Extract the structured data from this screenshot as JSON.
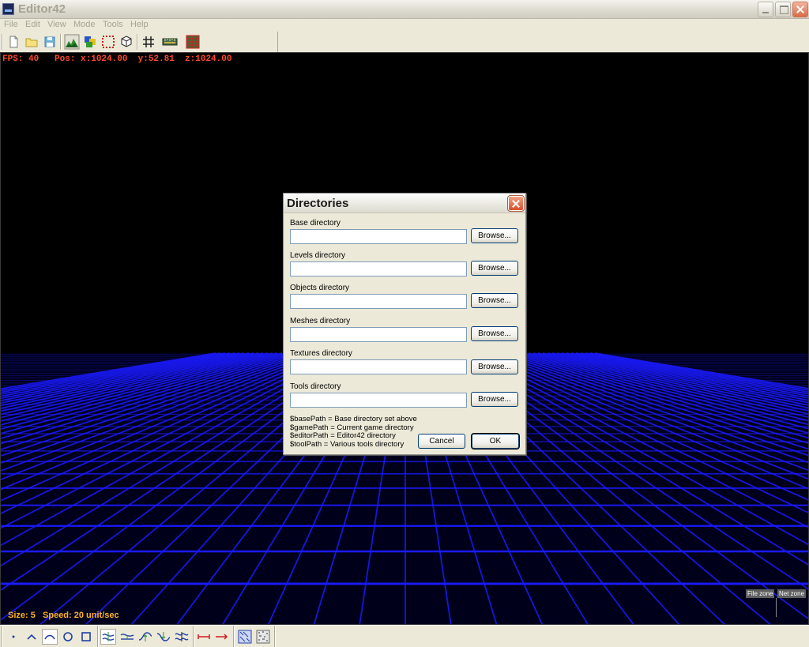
{
  "window": {
    "title": "Editor42"
  },
  "menu": [
    "File",
    "Edit",
    "View",
    "Mode",
    "Tools",
    "Help"
  ],
  "toolbar": {
    "icons": [
      "new-file-icon",
      "open-folder-icon",
      "save-icon",
      "terrain-icon",
      "layers-icon",
      "selection-icon",
      "cube-icon",
      "grid-icon",
      "ruler-icon",
      "tile-grid-icon"
    ]
  },
  "viewport": {
    "hud_top": "FPS: 40   Pos: x:1024.00  y:52.81  z:1024.00",
    "hud_bottom": "Size: 5   Speed: 20 unit/sec",
    "zone_file": "File zone",
    "zone_net": "Net zone",
    "grid_color": "#1a1aff"
  },
  "bottom_toolbar": {
    "icons": [
      "point-icon",
      "peak-icon",
      "curve-icon",
      "circle-icon",
      "square-icon",
      "smooth-icon",
      "flatten-icon",
      "raise-icon",
      "lower-icon",
      "wave-icon",
      "measure-icon",
      "arrow-icon",
      "texture-icon",
      "noise-icon"
    ]
  },
  "dialog": {
    "title": "Directories",
    "fields": [
      {
        "label": "Base directory",
        "value": "",
        "button": "Browse..."
      },
      {
        "label": "Levels directory",
        "value": "",
        "button": "Browse..."
      },
      {
        "label": "Objects directory",
        "value": "",
        "button": "Browse..."
      },
      {
        "label": "Meshes directory",
        "value": "",
        "button": "Browse..."
      },
      {
        "label": "Textures directory",
        "value": "",
        "button": "Browse..."
      },
      {
        "label": "Tools directory",
        "value": "",
        "button": "Browse..."
      }
    ],
    "help": [
      "$basePath = Base directory set above",
      "$gamePath = Current game directory",
      "$editorPath = Editor42 directory",
      "$toolPath = Various tools directory"
    ],
    "cancel": "Cancel",
    "ok": "OK"
  }
}
